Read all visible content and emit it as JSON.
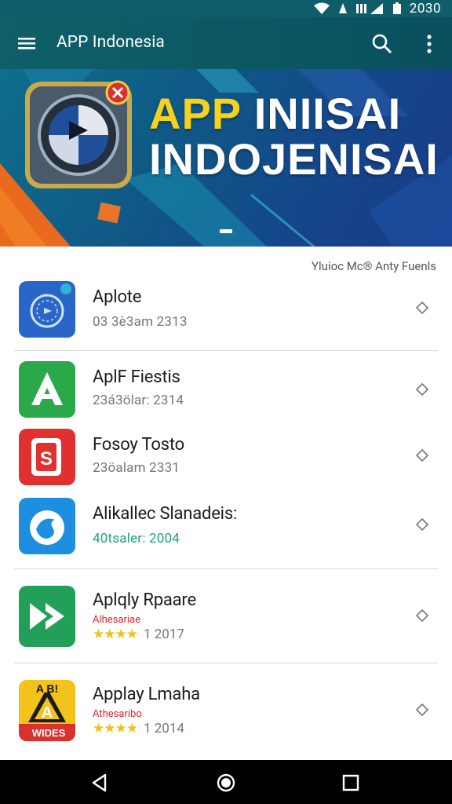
{
  "status_bar": {
    "time": "2030"
  },
  "app_bar": {
    "title": "APP Indonesia",
    "menu_icon": "menu-icon",
    "search_icon": "search-icon",
    "more_icon": "more-vert-icon"
  },
  "banner": {
    "line1_accent": "APP",
    "line1_rest": " INIISAI",
    "line2": "INDOJENISAI"
  },
  "section": {
    "header": "Yluioc Mc® Anty Fuenls"
  },
  "apps": [
    {
      "name": "Aplote",
      "meta": "03 3è3am 2313"
    },
    {
      "name": "AplF Fiestis",
      "meta": "23á3ölar: 2314"
    },
    {
      "name": "Fosoy Tosto",
      "meta": "23öalam 2331"
    },
    {
      "name": "Alikallec Slanadeis:",
      "meta": "40tsaler: 2004"
    },
    {
      "name": "Aplqly Rpaare",
      "sub": "Alhesariae",
      "stars": "★★★★",
      "rating": "1 2017"
    },
    {
      "name": "Applay Lmaha",
      "sub": "Athesaribo",
      "stars": "★★★★",
      "rating": "1 2014"
    }
  ],
  "icon6_text": {
    "top": "A B!",
    "bottom": "WIDES"
  },
  "colors": {
    "app_bar": "#0e5f69",
    "banner": "#14468a",
    "accent": "#f4d21d",
    "star": "#f2c01a"
  }
}
